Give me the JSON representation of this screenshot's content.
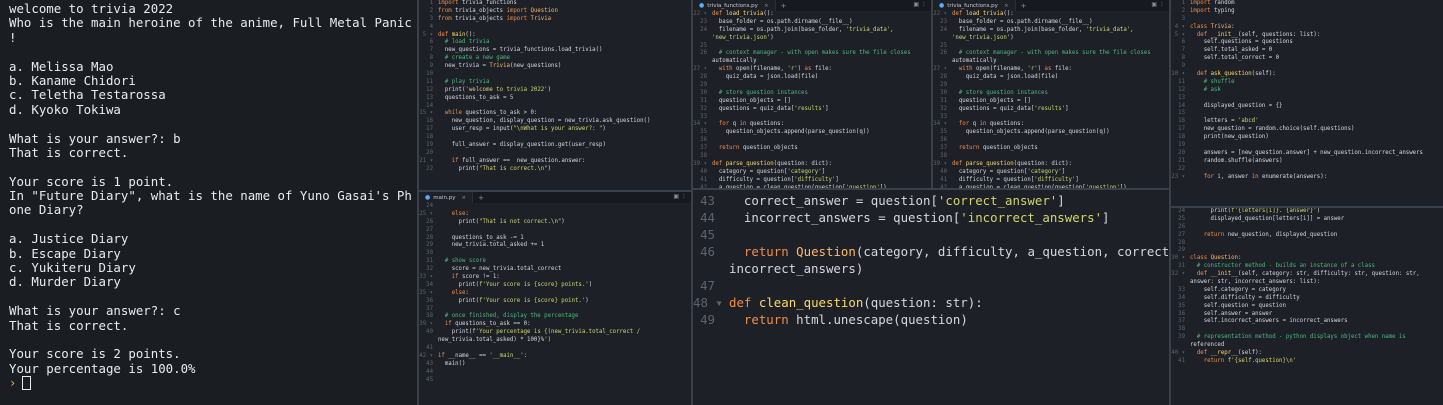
{
  "terminal": {
    "lines": [
      "welcome to trivia 2022",
      "Who is the main heroine of the anime, Full Metal Panic",
      "!",
      "",
      "a. Melissa Mao",
      "b. Kaname Chidori",
      "c. Teletha Testarossa",
      "d. Kyoko Tokiwa",
      "",
      "What is your answer?: b",
      "That is correct.",
      "",
      "Your score is 1 point.",
      "In \"Future Diary\", what is the name of Yuno Gasai's Ph",
      "one Diary?",
      "",
      "a. Justice Diary",
      "b. Escape Diary",
      "c. Yukiteru Diary",
      "d. Murder Diary",
      "",
      "What is your answer?: c",
      "That is correct.",
      "",
      "Your score is 2 points.",
      "Your percentage is 100.0%"
    ],
    "prompt": "›"
  },
  "editor_main_top": {
    "lines": [
      {
        "n": "1",
        "t": "import trivia_functions"
      },
      {
        "n": "2",
        "t": "from trivia_objects import Question"
      },
      {
        "n": "3",
        "t": "from trivia_objects import Trivia"
      },
      {
        "n": "4",
        "t": ""
      },
      {
        "n": "5 ▾",
        "t": "def main():"
      },
      {
        "n": "6",
        "t": "  # load trivia"
      },
      {
        "n": "7",
        "t": "  new_questions = trivia_functions.load_trivia()"
      },
      {
        "n": "8",
        "t": "  # create a new game"
      },
      {
        "n": "9",
        "t": "  new_trivia = Trivia(new_questions)"
      },
      {
        "n": "10",
        "t": ""
      },
      {
        "n": "11",
        "t": "  # play trivia"
      },
      {
        "n": "12",
        "t": "  print('welcome to trivia 2022')"
      },
      {
        "n": "13",
        "t": "  questions_to_ask = 5"
      },
      {
        "n": "14",
        "t": ""
      },
      {
        "n": "15 ▾",
        "t": "  while questions_to_ask > 0:"
      },
      {
        "n": "16",
        "t": "    new_question, display_question = new_trivia.ask_question()"
      },
      {
        "n": "17",
        "t": "    user_resp = input(\"\\nWhat is your answer?: \")"
      },
      {
        "n": "18",
        "t": ""
      },
      {
        "n": "19",
        "t": "    full_answer = display_question.get(user_resp)"
      },
      {
        "n": "20",
        "t": ""
      },
      {
        "n": "21 ▾",
        "t": "    if full_answer ==  new_question.answer:"
      },
      {
        "n": "22",
        "t": "      print(\"That is correct.\\n\")"
      }
    ]
  },
  "editor_main_bottom": {
    "tab": "main.py",
    "lines": [
      {
        "n": "24",
        "t": ""
      },
      {
        "n": "25 ▾",
        "t": "    else:"
      },
      {
        "n": "26",
        "t": "      print(\"That is not correct.\\n\")"
      },
      {
        "n": "27",
        "t": ""
      },
      {
        "n": "28",
        "t": "    questions_to_ask -= 1"
      },
      {
        "n": "29",
        "t": "    new_trivia.total_asked += 1"
      },
      {
        "n": "30",
        "t": ""
      },
      {
        "n": "31",
        "t": "  # show score"
      },
      {
        "n": "32",
        "t": "    score = new_trivia.total_correct"
      },
      {
        "n": "33 ▾",
        "t": "    if score != 1:"
      },
      {
        "n": "34",
        "t": "      print(f'Your score is {score} points.')"
      },
      {
        "n": "35 ▾",
        "t": "    else:"
      },
      {
        "n": "36",
        "t": "      print(f'Your score is {score} point.')"
      },
      {
        "n": "37",
        "t": ""
      },
      {
        "n": "38",
        "t": "  # once finished, display the percentage"
      },
      {
        "n": "39 ▾",
        "t": "  if questions_to_ask == 0:"
      },
      {
        "n": "40",
        "t": "    print(f'Your percentage is {(new_trivia.total_correct /"
      },
      {
        "n": "",
        "t": "new_trivia.total_asked) * 100}%')"
      },
      {
        "n": "41",
        "t": ""
      },
      {
        "n": "42 ▾",
        "t": "if __name__ == '__main__':"
      },
      {
        "n": "43",
        "t": "  main()"
      },
      {
        "n": "44",
        "t": ""
      },
      {
        "n": "45",
        "t": ""
      }
    ]
  },
  "editor_functions_a": {
    "tab": "trivia_functions.py",
    "lines": [
      {
        "n": "22 ▾",
        "t": "def load_trivia():"
      },
      {
        "n": "23",
        "t": "  base_folder = os.path.dirname(__file__)"
      },
      {
        "n": "24",
        "t": "  filename = os.path.join(base_folder, 'trivia_data',"
      },
      {
        "n": "",
        "t": "'new_trivia.json')"
      },
      {
        "n": "25",
        "t": ""
      },
      {
        "n": "26",
        "t": "  # context manager - with open makes sure the file closes"
      },
      {
        "n": "",
        "t": "automatically"
      },
      {
        "n": "27 ▾",
        "t": "  with open(filename, 'r') as file:"
      },
      {
        "n": "28",
        "t": "    quiz_data = json.load(file)"
      },
      {
        "n": "29",
        "t": ""
      },
      {
        "n": "30",
        "t": "  # store question instances"
      },
      {
        "n": "31",
        "t": "  question_objects = []"
      },
      {
        "n": "32",
        "t": "  questions = quiz_data['results']"
      },
      {
        "n": "33",
        "t": ""
      },
      {
        "n": "34 ▾",
        "t": "  for q in questions:"
      },
      {
        "n": "35",
        "t": "    question_objects.append(parse_question(q))"
      },
      {
        "n": "36",
        "t": ""
      },
      {
        "n": "37",
        "t": "  return question_objects"
      },
      {
        "n": "38",
        "t": ""
      },
      {
        "n": "39 ▾",
        "t": "def parse_question(question: dict):"
      },
      {
        "n": "40",
        "t": "  category = question['category']"
      },
      {
        "n": "41",
        "t": "  difficulty = question['difficulty']"
      },
      {
        "n": "42",
        "t": "  a_question = clean_question(question['question'])"
      }
    ]
  },
  "editor_functions_b": {
    "tab": "trivia_functions.py",
    "lines": [
      {
        "n": "22 ▾",
        "t": "def load_trivia():"
      },
      {
        "n": "23",
        "t": "  base_folder = os.path.dirname(__file__)"
      },
      {
        "n": "24",
        "t": "  filename = os.path.join(base_folder, 'trivia_data',"
      },
      {
        "n": "",
        "t": "'new_trivia.json')"
      },
      {
        "n": "25",
        "t": ""
      },
      {
        "n": "26",
        "t": "  # context manager - with open makes sure the file closes"
      },
      {
        "n": "",
        "t": "automatically"
      },
      {
        "n": "27 ▾",
        "t": "  with open(filename, 'r') as file:"
      },
      {
        "n": "28",
        "t": "    quiz_data = json.load(file)"
      },
      {
        "n": "29",
        "t": ""
      },
      {
        "n": "30",
        "t": "  # store question instances"
      },
      {
        "n": "31",
        "t": "  question_objects = []"
      },
      {
        "n": "32",
        "t": "  questions = quiz_data['results']"
      },
      {
        "n": "33",
        "t": ""
      },
      {
        "n": "34 ▾",
        "t": "  for q in questions:"
      },
      {
        "n": "35",
        "t": "    question_objects.append(parse_question(q))"
      },
      {
        "n": "36",
        "t": ""
      },
      {
        "n": "37",
        "t": "  return question_objects"
      },
      {
        "n": "38",
        "t": ""
      },
      {
        "n": "39 ▾",
        "t": "def parse_question(question: dict):"
      },
      {
        "n": "40",
        "t": "  category = question['category']"
      },
      {
        "n": "41",
        "t": "  difficulty = question['difficulty']"
      },
      {
        "n": "42",
        "t": "  a_question = clean_question(question['question'])"
      }
    ]
  },
  "editor_functions_zoom": {
    "lines": [
      {
        "n": "43",
        "t": "  correct_answer = question['correct_answer']"
      },
      {
        "n": "44",
        "t": "  incorrect_answers = question['incorrect_answers']"
      },
      {
        "n": "45",
        "t": ""
      },
      {
        "n": "46",
        "t": "  return Question(category, difficulty, a_question, correct_answer,"
      },
      {
        "n": "",
        "t": "incorrect_answers)"
      },
      {
        "n": "47",
        "t": ""
      },
      {
        "n": "48 ▾",
        "t": "def clean_question(question: str):"
      },
      {
        "n": "49",
        "t": "  return html.unescape(question)"
      }
    ]
  },
  "editor_objects_top": {
    "lines": [
      {
        "n": "1",
        "t": "import random"
      },
      {
        "n": "2",
        "t": "import typing"
      },
      {
        "n": "3",
        "t": ""
      },
      {
        "n": "4 ▾",
        "t": "class Trivia:"
      },
      {
        "n": "5 ▾",
        "t": "  def __init__(self, questions: list):"
      },
      {
        "n": "6",
        "t": "    self.questions = questions"
      },
      {
        "n": "7",
        "t": "    self.total_asked = 0"
      },
      {
        "n": "8",
        "t": "    self.total_correct = 0"
      },
      {
        "n": "9",
        "t": ""
      },
      {
        "n": "10 ▾",
        "t": "  def ask_question(self):"
      },
      {
        "n": "11",
        "t": "    # shuffle"
      },
      {
        "n": "12",
        "t": "    # ask"
      },
      {
        "n": "13",
        "t": ""
      },
      {
        "n": "14",
        "t": "    displayed_question = {}"
      },
      {
        "n": "15",
        "t": ""
      },
      {
        "n": "16",
        "t": "    letters = 'abcd'"
      },
      {
        "n": "17",
        "t": "    new_question = random.choice(self.questions)"
      },
      {
        "n": "18",
        "t": "    print(new_question)"
      },
      {
        "n": "19",
        "t": ""
      },
      {
        "n": "20",
        "t": "    answers = [new_question.answer] + new_question.incorrect_answers"
      },
      {
        "n": "21",
        "t": "    random.shuffle(answers)"
      },
      {
        "n": "22",
        "t": ""
      },
      {
        "n": "23 ▾",
        "t": "    for i, answer in enumerate(answers):"
      }
    ]
  },
  "editor_objects_bottom": {
    "lines": [
      {
        "n": "24",
        "t": "      print(f'{letters[i]}. {answer}')"
      },
      {
        "n": "25",
        "t": "      displayed_question[letters[i]] = answer"
      },
      {
        "n": "26",
        "t": ""
      },
      {
        "n": "27",
        "t": "    return new_question, displayed_question"
      },
      {
        "n": "28",
        "t": ""
      },
      {
        "n": "29",
        "t": ""
      },
      {
        "n": "30 ▾",
        "t": "class Question:"
      },
      {
        "n": "31",
        "t": "  # constructor method - builds an instance of a class"
      },
      {
        "n": "32 ▾",
        "t": "  def __init__(self, category: str, difficulty: str, question: str,"
      },
      {
        "n": "",
        "t": "answer: str, incorrect_answers: list):"
      },
      {
        "n": "33",
        "t": "    self.category = category"
      },
      {
        "n": "34",
        "t": "    self.difficulty = difficulty"
      },
      {
        "n": "35",
        "t": "    self.question = question"
      },
      {
        "n": "36",
        "t": "    self.answer = answer"
      },
      {
        "n": "37",
        "t": "    self.incorrect_answers = incorrect_answers"
      },
      {
        "n": "38",
        "t": ""
      },
      {
        "n": "39",
        "t": "  # representation method - python displays object when name is"
      },
      {
        "n": "",
        "t": "referenced"
      },
      {
        "n": "40 ▾",
        "t": "  def __repr__(self):"
      },
      {
        "n": "41",
        "t": "    return f'{self.question}\\n'"
      }
    ]
  },
  "tab_controls": {
    "close": "×",
    "add": "+",
    "tools": "▣ ⋮"
  }
}
